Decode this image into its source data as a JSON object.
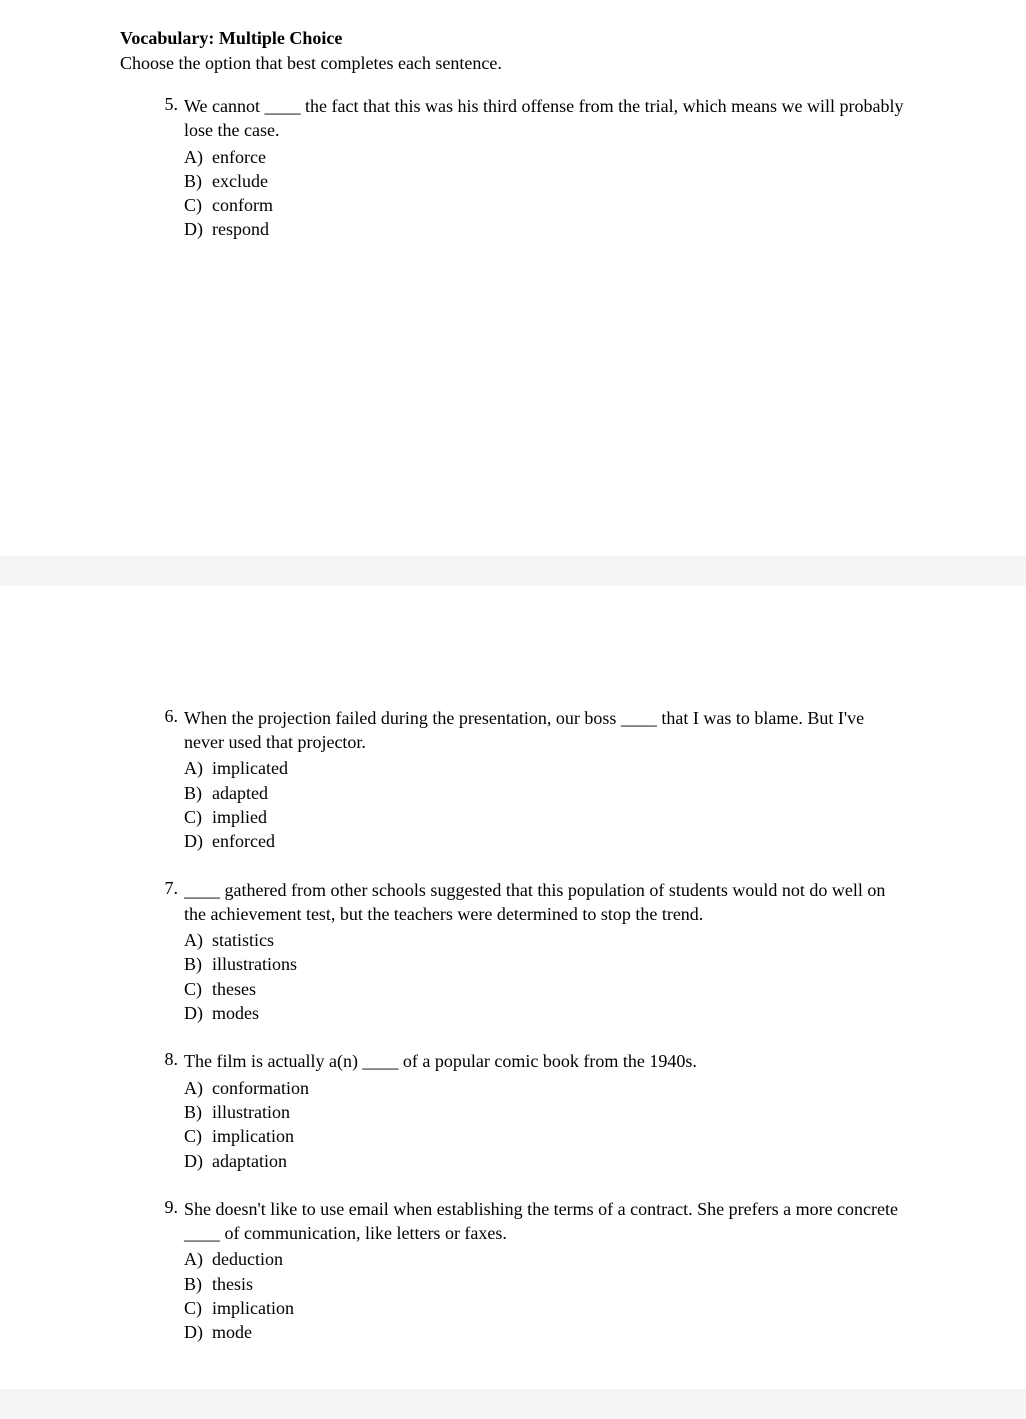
{
  "header": {
    "title": "Vocabulary: Multiple Choice",
    "instruction": "Choose the option that best completes each sentence."
  },
  "questions": [
    {
      "number": "5.",
      "text": "We cannot ____ the fact that this was his third offense from the trial, which means we will probably lose the case.",
      "options": {
        "A": "enforce",
        "B": "exclude",
        "C": "conform",
        "D": "respond"
      }
    },
    {
      "number": "6.",
      "text": "When the projection failed during the presentation, our boss ____ that I was to blame. But I've never used that projector.",
      "options": {
        "A": "implicated",
        "B": "adapted",
        "C": "implied",
        "D": "enforced"
      }
    },
    {
      "number": "7.",
      "text": "____ gathered from other schools suggested that this population of students would not do well on the achievement test, but the teachers were determined to stop the trend.",
      "options": {
        "A": "statistics",
        "B": "illustrations",
        "C": "theses",
        "D": "modes"
      }
    },
    {
      "number": "8.",
      "text": "The film is actually a(n) ____ of a popular comic book from the 1940s.",
      "options": {
        "A": "conformation",
        "B": "illustration",
        "C": "implication",
        "D": "adaptation"
      }
    },
    {
      "number": "9.",
      "text": "She doesn't like to use email when establishing the terms of a contract. She prefers a more concrete ____ of communication, like letters or faxes.",
      "options": {
        "A": "deduction",
        "B": "thesis",
        "C": "implication",
        "D": "mode"
      }
    }
  ],
  "option_labels": {
    "A": "A)",
    "B": "B)",
    "C": "C)",
    "D": "D)"
  }
}
